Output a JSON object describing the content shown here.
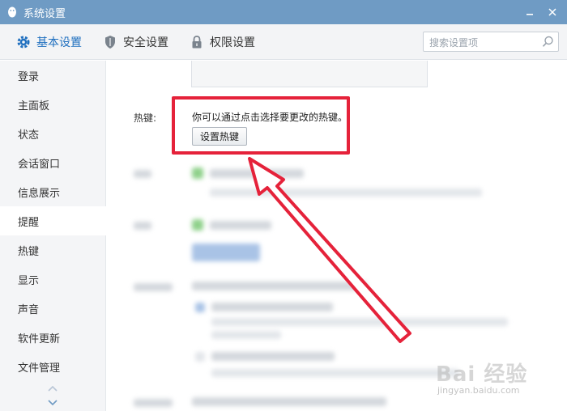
{
  "window": {
    "title": "系统设置"
  },
  "nav": {
    "tabs": [
      {
        "label": "基本设置",
        "active": true
      },
      {
        "label": "安全设置",
        "active": false
      },
      {
        "label": "权限设置",
        "active": false
      }
    ],
    "search_placeholder": "搜索设置项"
  },
  "sidebar": {
    "items": [
      {
        "label": "登录"
      },
      {
        "label": "主面板"
      },
      {
        "label": "状态"
      },
      {
        "label": "会话窗口"
      },
      {
        "label": "信息展示"
      },
      {
        "label": "提醒",
        "active": true
      },
      {
        "label": "热键"
      },
      {
        "label": "显示"
      },
      {
        "label": "声音"
      },
      {
        "label": "软件更新"
      },
      {
        "label": "文件管理"
      }
    ]
  },
  "hotkey": {
    "label": "热键:",
    "description": "你可以通过点击选择要更改的热键。",
    "button_label": "设置热键"
  },
  "colors": {
    "titlebar": "#6f9bc4",
    "accent": "#1f6fbf",
    "highlight": "#e5223a"
  },
  "watermark": {
    "brand": "Bai 经验",
    "url": "jingyan.baidu.com"
  }
}
